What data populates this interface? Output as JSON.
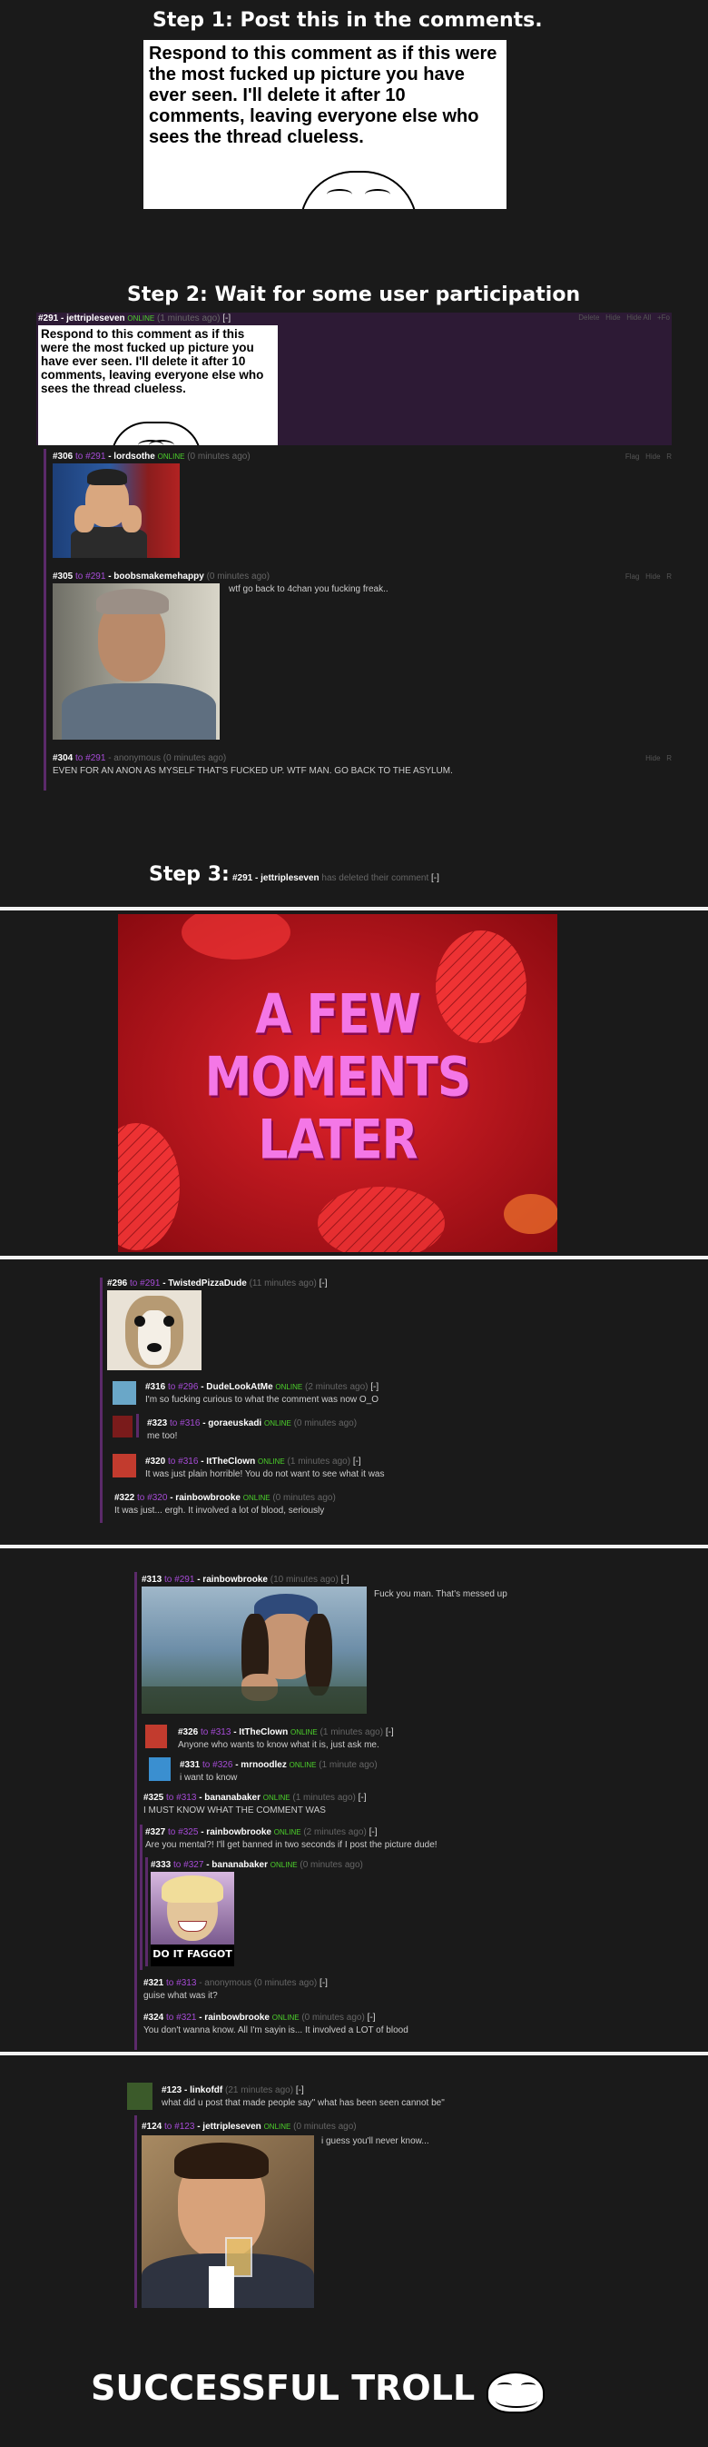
{
  "step1": {
    "title": "Step 1: Post this in the comments.",
    "card_text": "Respond to this comment as if this were the most fucked up picture you have ever seen. I'll delete it after 10 comments, leaving everyone else who sees the thread clueless."
  },
  "step2": {
    "title": "Step 2: Wait for some user participation",
    "op": {
      "num": "#291",
      "user": "jettripleseven",
      "status": "ONLINE",
      "time": "(1 minutes ago)",
      "toggle": "[-]",
      "actions": [
        "Delete",
        "Hide",
        "Hide All",
        "+Fo"
      ],
      "card_text": "Respond to this comment as if this were the most fucked up picture you have ever seen. I'll delete it after 10 comments, leaving everyone else who sees the thread clueless."
    },
    "replies": [
      {
        "num": "#306",
        "to": "#291",
        "user": "lordsothe",
        "status": "ONLINE",
        "time": "(0 minutes ago)",
        "actions": [
          "Flag",
          "Hide",
          "R"
        ],
        "text": ""
      },
      {
        "num": "#305",
        "to": "#291",
        "user": "boobsmakemehappy",
        "status": "",
        "time": "(0 minutes ago)",
        "actions": [
          "Flag",
          "Hide",
          "R"
        ],
        "text": "wtf go back to 4chan you fucking freak.."
      },
      {
        "num": "#304",
        "to": "#291",
        "user": "anonymous",
        "status": "",
        "time": "(0 minutes ago)",
        "actions": [
          "Hide",
          "R"
        ],
        "text": "EVEN FOR AN ANON AS MYSELF THAT'S FUCKED UP. WTF MAN. GO BACK TO THE ASYLUM."
      }
    ]
  },
  "step3": {
    "title": "Step 3:",
    "num": "#291",
    "user": "jettripleseven",
    "deleted": "has deleted their comment",
    "toggle": "[-]"
  },
  "moments_later": {
    "line1": "A FEW",
    "line2": "MOMENTS LATER"
  },
  "thread_a": [
    {
      "num": "#296",
      "to": "#291",
      "user": "TwistedPizzaDude",
      "status": "",
      "time": "(11 minutes ago)",
      "toggle": "[-]",
      "text": ""
    },
    {
      "num": "#316",
      "to": "#296",
      "user": "DudeLookAtMe",
      "status": "ONLINE",
      "time": "(2 minutes ago)",
      "toggle": "[-]",
      "text": "I'm so fucking curious to what the comment was now O_O"
    },
    {
      "num": "#323",
      "to": "#316",
      "user": "goraeuskadi",
      "status": "ONLINE",
      "time": "(0 minutes ago)",
      "toggle": "",
      "text": "me too!"
    },
    {
      "num": "#320",
      "to": "#316",
      "user": "ItTheClown",
      "status": "ONLINE",
      "time": "(1 minutes ago)",
      "toggle": "[-]",
      "text": "It was just plain horrible! You do not want to see what it was"
    },
    {
      "num": "#322",
      "to": "#320",
      "user": "rainbowbrooke",
      "status": "ONLINE",
      "time": "(0 minutes ago)",
      "toggle": "",
      "text": "It was just... ergh. It involved a lot of blood, seriously"
    }
  ],
  "thread_b": [
    {
      "num": "#313",
      "to": "#291",
      "user": "rainbowbrooke",
      "status": "",
      "time": "(10 minutes ago)",
      "toggle": "[-]",
      "text": "Fuck you man. That's messed up"
    },
    {
      "num": "#326",
      "to": "#313",
      "user": "ItTheClown",
      "status": "ONLINE",
      "time": "(1 minutes ago)",
      "toggle": "[-]",
      "text": "Anyone who wants to know what it is, just ask me."
    },
    {
      "num": "#331",
      "to": "#326",
      "user": "mrnoodlez",
      "status": "ONLINE",
      "time": "(1 minute ago)",
      "toggle": "",
      "text": "i want to know"
    },
    {
      "num": "#325",
      "to": "#313",
      "user": "bananabaker",
      "status": "ONLINE",
      "time": "(1 minutes ago)",
      "toggle": "[-]",
      "text": "I MUST KNOW WHAT THE COMMENT WAS"
    },
    {
      "num": "#327",
      "to": "#325",
      "user": "rainbowbrooke",
      "status": "ONLINE",
      "time": "(2 minutes ago)",
      "toggle": "[-]",
      "text": "Are you mental?! I'll get banned in two seconds if I post the picture dude!"
    },
    {
      "num": "#333",
      "to": "#327",
      "user": "bananabaker",
      "status": "ONLINE",
      "time": "(0 minutes ago)",
      "toggle": "",
      "text": ""
    },
    {
      "num": "#321",
      "to": "#313",
      "user": "anonymous",
      "status": "",
      "time": "(0 minutes ago)",
      "toggle": "[-]",
      "text": "guise what was it?"
    },
    {
      "num": "#324",
      "to": "#321",
      "user": "rainbowbrooke",
      "status": "ONLINE",
      "time": "(0 minutes ago)",
      "toggle": "[-]",
      "text": "You don't wanna know. All I'm sayin is... It involved a LOT of blood"
    }
  ],
  "meme_caption": "DO IT FAGGOT",
  "thread_c": [
    {
      "num": "#123",
      "to": "",
      "user": "linkofdf",
      "status": "",
      "time": "(21 minutes ago)",
      "toggle": "[-]",
      "text": "what did u post that made people say\" what has been seen cannot be\""
    },
    {
      "num": "#124",
      "to": "#123",
      "user": "jettripleseven",
      "status": "ONLINE",
      "time": "(0 minutes ago)",
      "toggle": "",
      "text": "i guess you'll never know..."
    }
  ],
  "footer": "SUCCESSFUL TROLL"
}
